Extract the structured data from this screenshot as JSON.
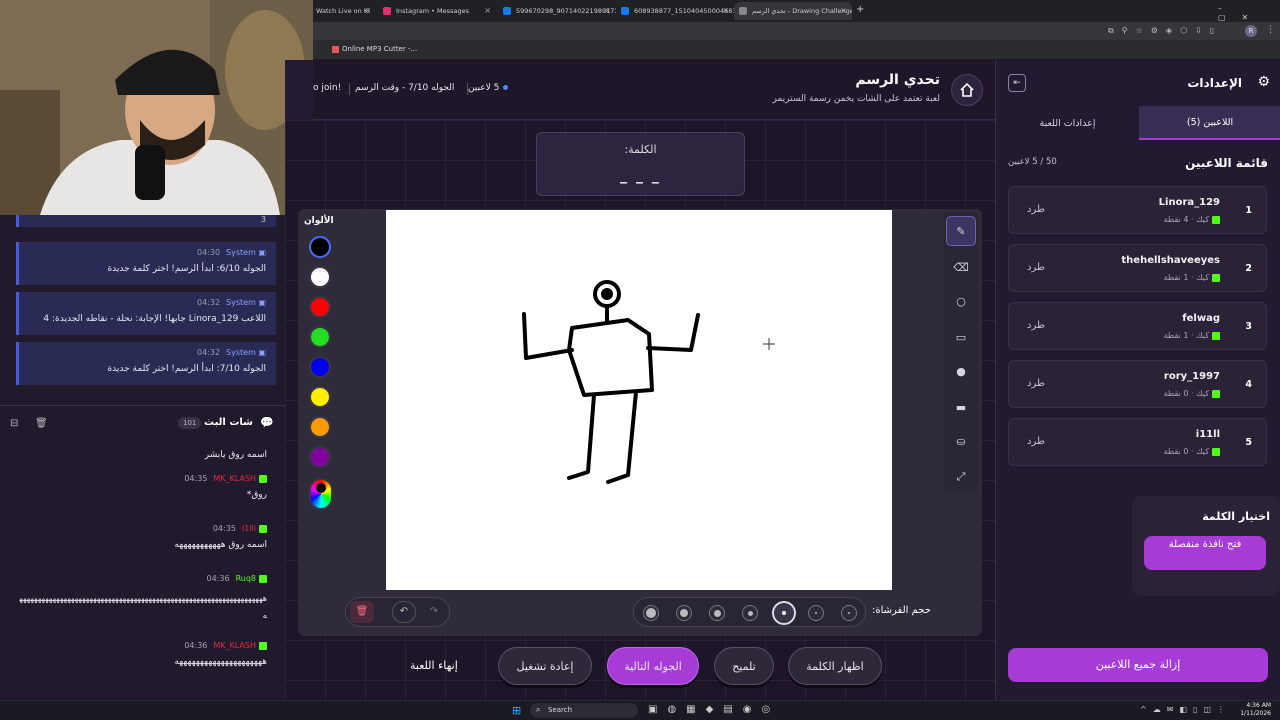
{
  "browser": {
    "tabs": [
      {
        "label": "Watch Live on Ki",
        "color": "#53fc18"
      },
      {
        "label": "Instagram • Messages",
        "color": "#e1306c"
      },
      {
        "label": "599670298_907140221989173",
        "color": "#1877f2"
      },
      {
        "label": "608938877_151040450004683",
        "color": "#1877f2"
      },
      {
        "label": "تحدي الرسم - Drawing Challenge",
        "color": "#888888"
      }
    ],
    "bookmark": "Online MP3 Cutter -...",
    "profile_initial": "R"
  },
  "header": {
    "title": "تحدي الرسم",
    "subtitle": "لعبة تعتمد على الشات يخمن رسمة الستريمر",
    "players_count": "5 لاعبين",
    "round_info": "الجوله 7/10 - وقت الرسم",
    "scroll_text": "o join!"
  },
  "word": {
    "label": "الكلمة:",
    "blanks": "_ _ _"
  },
  "palette": {
    "title": "الألوان",
    "colors": [
      "#000000",
      "#ffffff",
      "#ff0000",
      "#22dd22",
      "#0000ee",
      "#ffee00",
      "#ff9900",
      "#8000a0"
    ]
  },
  "brush": {
    "label": "حجم الفرشاة:"
  },
  "controls": {
    "end_game": "إنهاء اللعبة",
    "restart": "إعادة تشغيل",
    "next_round": "الجوله التالية",
    "hint": "تلميح",
    "show_word": "اظهار الكلمة"
  },
  "settings": {
    "title": "الإعدادات",
    "tab_players": "اللاعبين (5)",
    "tab_game": "إعدادات اللعبة",
    "list_title": "قائمة اللاعبين",
    "capacity": "50 / 5 لاعبين",
    "kick_label": "طرد",
    "players": [
      {
        "rank": "1",
        "name": "Linora_129",
        "sub": "كيك · 4 نقطة"
      },
      {
        "rank": "2",
        "name": "thehellshaveeyes",
        "sub": "كيك · 1 نقطة"
      },
      {
        "rank": "3",
        "name": "felwag",
        "sub": "كيك · 1 نقطة"
      },
      {
        "rank": "4",
        "name": "rory_1997",
        "sub": "كيك · 0 نقطة"
      },
      {
        "rank": "5",
        "name": "i11ll",
        "sub": "كيك · 0 نقطة"
      }
    ],
    "pick_word_title": "اختيار الكلمة",
    "pick_word_button": "فتح نافذة منفصلة",
    "remove_all": "إزالة جميع اللاعبين"
  },
  "chat": {
    "top_count": "3",
    "system_messages": [
      {
        "user": "System",
        "time": "04:30",
        "text": "الجوله 6/10: ابدأ الرسم! اختر كلمة جديدة"
      },
      {
        "user": "System",
        "time": "04:32",
        "text": "اللاعب Linora_129 جابها! الإجابة: نحلة - نقاطه الجديدة: 4"
      },
      {
        "user": "System",
        "time": "04:32",
        "text": "الجوله 7/10: ابدأ الرسم! اختر كلمة جديدة"
      }
    ],
    "title": "شات البث",
    "count": "101",
    "messages": [
      {
        "user": "",
        "time": "",
        "text": "اسمه روق يابشر",
        "color": "#ffffff"
      },
      {
        "user": "MK_KLASH",
        "time": "04:35",
        "text": "روق*",
        "color": "#e8283c"
      },
      {
        "user": "I1lll",
        "time": "04:35",
        "text": "اسمه روق هههههههههههه",
        "color": "#e8283c"
      },
      {
        "user": "Ruq8",
        "time": "04:36",
        "text": "هههههههههههههههههههههههههههههههههههههههههههههههههههههههههههههههههههه",
        "color": "#53fc18"
      },
      {
        "user": "MK_KLASH",
        "time": "04:36",
        "text": "هههههههههههههههههههههه",
        "color": "#e8283c"
      }
    ]
  },
  "taskbar": {
    "search": "Search",
    "time": "4:36 AM",
    "date": "1/11/2026"
  }
}
